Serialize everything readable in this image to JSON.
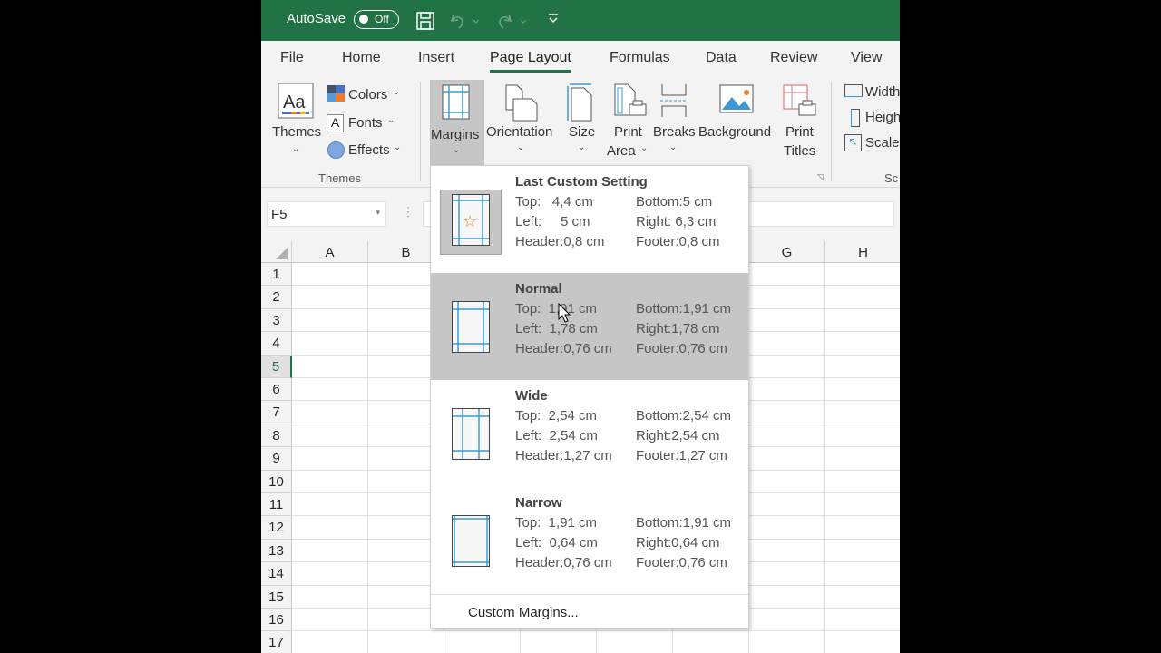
{
  "titlebar": {
    "autosave_label": "AutoSave",
    "autosave_state": "Off",
    "icons": [
      "save-icon",
      "undo-icon",
      "redo-icon",
      "customize-qat-icon"
    ]
  },
  "tabs": [
    {
      "label": "File"
    },
    {
      "label": "Home"
    },
    {
      "label": "Insert"
    },
    {
      "label": "Page Layout",
      "active": true
    },
    {
      "label": "Formulas"
    },
    {
      "label": "Data"
    },
    {
      "label": "Review"
    },
    {
      "label": "View"
    }
  ],
  "ribbon": {
    "themes": {
      "label": "Themes",
      "colors": "Colors",
      "fonts": "Fonts",
      "effects": "Effects",
      "group": "Themes"
    },
    "margins": "Margins",
    "orientation": "Orientation",
    "size": "Size",
    "print_area_1": "Print",
    "print_area_2": "Area",
    "breaks": "Breaks",
    "background": "Background",
    "print_titles_1": "Print",
    "print_titles_2": "Titles",
    "width": "Width",
    "height": "Heigh",
    "scale": "Scale",
    "scale_group": "Sc"
  },
  "formula_bar": {
    "name_box": "F5"
  },
  "grid": {
    "columns": [
      "A",
      "B",
      "",
      "",
      "",
      "",
      "G",
      "H"
    ],
    "rows": [
      "1",
      "2",
      "3",
      "4",
      "5",
      "6",
      "7",
      "8",
      "9",
      "10",
      "11",
      "12",
      "13",
      "14",
      "15",
      "16",
      "17"
    ],
    "selected_row": "5"
  },
  "margins_menu": {
    "options": [
      {
        "title": "Last Custom Setting",
        "icon": "margins-custom-star-icon",
        "top": "Top:   4,4 cm",
        "bottom": "Bottom:5 cm",
        "left": "Left:     5 cm",
        "right": "Right: 6,3 cm",
        "header": "Header:0,8 cm",
        "footer": "Footer:0,8 cm"
      },
      {
        "title": "Normal",
        "icon": "margins-normal-icon",
        "hover": true,
        "top": "Top:  1,91 cm",
        "bottom": "Bottom:1,91 cm",
        "left": "Left:  1,78 cm",
        "right": "Right:1,78 cm",
        "header": "Header:0,76 cm",
        "footer": "Footer:0,76 cm"
      },
      {
        "title": "Wide",
        "icon": "margins-wide-icon",
        "top": "Top:  2,54 cm",
        "bottom": "Bottom:2,54 cm",
        "left": "Left:  2,54 cm",
        "right": "Right:2,54 cm",
        "header": "Header:1,27 cm",
        "footer": "Footer:1,27 cm"
      },
      {
        "title": "Narrow",
        "icon": "margins-narrow-icon",
        "top": "Top:  1,91 cm",
        "bottom": "Bottom:1,91 cm",
        "left": "Left:  0,64 cm",
        "right": "Right:0,64 cm",
        "header": "Header:0,76 cm",
        "footer": "Footer:0,76 cm"
      }
    ],
    "custom_label": "Custom Margins..."
  },
  "colors": {
    "brand": "#217346",
    "margin_line": "#3d9ad1"
  }
}
